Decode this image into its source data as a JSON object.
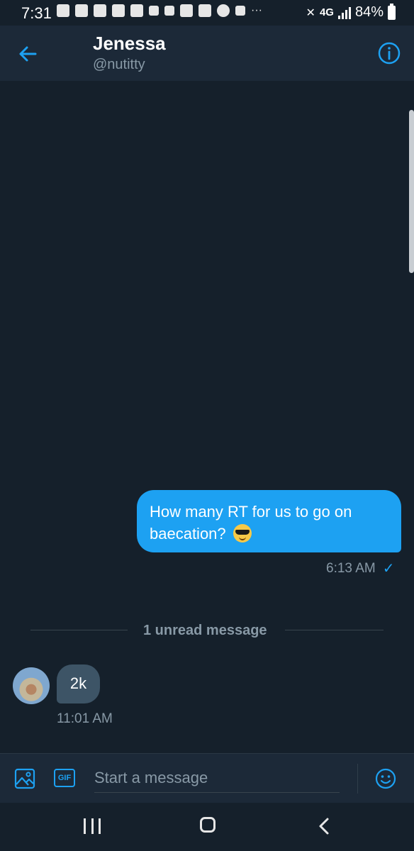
{
  "status_bar": {
    "time": "7:31",
    "network": "4G",
    "battery": "84%"
  },
  "header": {
    "name": "Jenessa",
    "handle": "@nutitty",
    "back_icon": "arrow-left-icon",
    "info_icon": "info-icon"
  },
  "messages": [
    {
      "direction": "outgoing",
      "text": "How many RT for us to go on baecation?",
      "emoji": "smiling-face-with-sunglasses",
      "time": "6:13 AM",
      "status": "sent"
    },
    {
      "direction": "incoming",
      "text": "2k",
      "time": "11:01 AM"
    }
  ],
  "divider": {
    "text": "1 unread message"
  },
  "composer": {
    "placeholder": "Start a message",
    "gif_label": "GIF"
  },
  "colors": {
    "background": "#15202b",
    "header": "#1c2938",
    "accent": "#1da1f2",
    "incoming_bubble": "#3d5466",
    "muted_text": "#8899a6"
  }
}
